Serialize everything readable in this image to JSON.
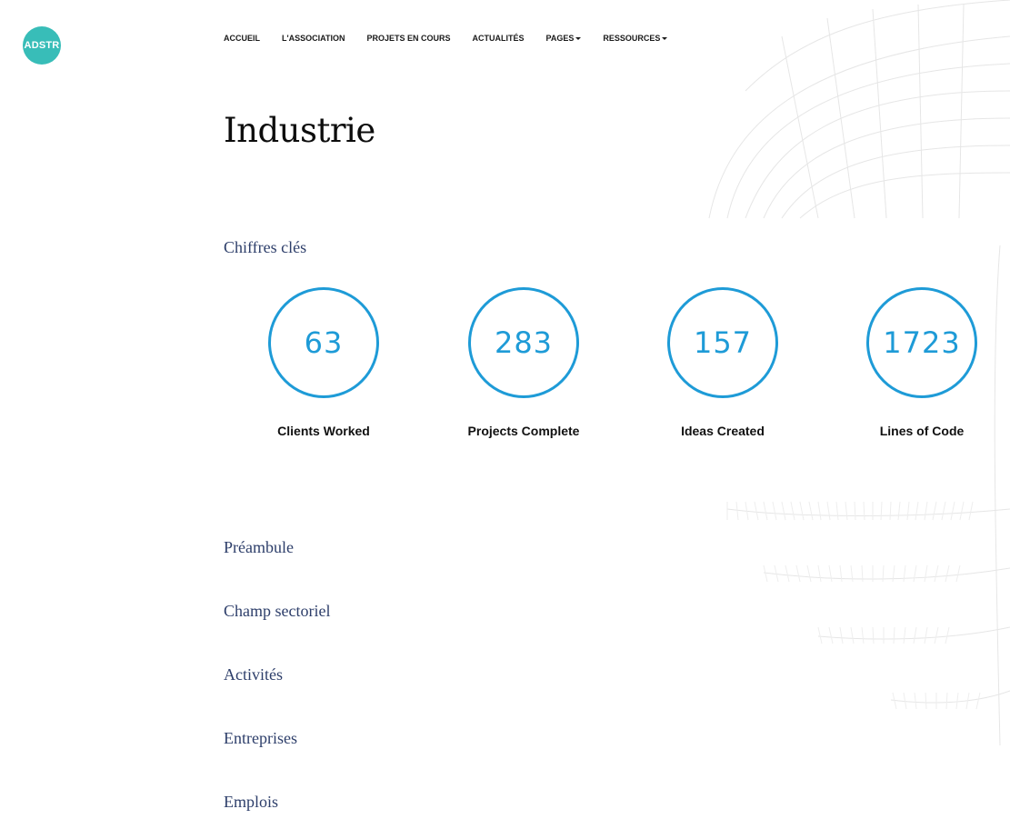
{
  "logo": {
    "text": "ADSTR",
    "color": "#38bdb8"
  },
  "nav": {
    "items": [
      {
        "label": "ACCUEIL",
        "dropdown": false
      },
      {
        "label": "L'ASSOCIATION",
        "dropdown": false
      },
      {
        "label": "PROJETS EN COURS",
        "dropdown": false
      },
      {
        "label": "ACTUALITÉS",
        "dropdown": false
      },
      {
        "label": "PAGES",
        "dropdown": true
      },
      {
        "label": "RESSOURCES",
        "dropdown": true
      }
    ]
  },
  "page": {
    "title": "Industrie"
  },
  "key_figures": {
    "heading": "Chiffres clés",
    "accent_color": "#1e9bd7",
    "stats": [
      {
        "value": "63",
        "label": "Clients Worked"
      },
      {
        "value": "283",
        "label": "Projects Complete"
      },
      {
        "value": "157",
        "label": "Ideas Created"
      },
      {
        "value": "1723",
        "label": "Lines of Code"
      }
    ]
  },
  "sections": [
    {
      "label": "Préambule"
    },
    {
      "label": "Champ sectoriel"
    },
    {
      "label": "Activités"
    },
    {
      "label": "Entreprises"
    },
    {
      "label": "Emplois"
    }
  ]
}
